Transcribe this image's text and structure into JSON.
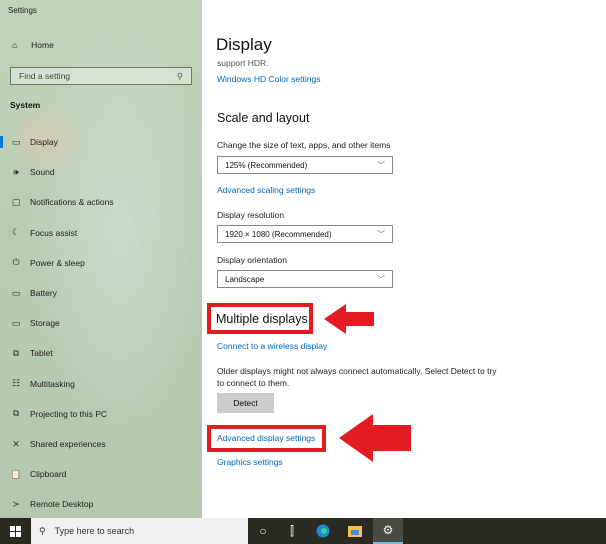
{
  "window": {
    "title": "Settings"
  },
  "sidebar": {
    "home_label": "Home",
    "search_placeholder": "Find a setting",
    "section": "System",
    "items": [
      {
        "label": "Display",
        "icon": "monitor-icon",
        "glyph": "▭",
        "active": true
      },
      {
        "label": "Sound",
        "icon": "speaker-icon",
        "glyph": "🕪"
      },
      {
        "label": "Notifications & actions",
        "icon": "notification-icon",
        "glyph": "▢"
      },
      {
        "label": "Focus assist",
        "icon": "moon-icon",
        "glyph": "☾"
      },
      {
        "label": "Power & sleep",
        "icon": "power-icon",
        "glyph": "⏻"
      },
      {
        "label": "Battery",
        "icon": "battery-icon",
        "glyph": "▭"
      },
      {
        "label": "Storage",
        "icon": "storage-icon",
        "glyph": "▭"
      },
      {
        "label": "Tablet",
        "icon": "tablet-icon",
        "glyph": "⧉"
      },
      {
        "label": "Multitasking",
        "icon": "multitasking-icon",
        "glyph": "☷"
      },
      {
        "label": "Projecting to this PC",
        "icon": "projecting-icon",
        "glyph": "⧉"
      },
      {
        "label": "Shared experiences",
        "icon": "shared-icon",
        "glyph": "✕"
      },
      {
        "label": "Clipboard",
        "icon": "clipboard-icon",
        "glyph": "📋"
      },
      {
        "label": "Remote Desktop",
        "icon": "remote-desktop-icon",
        "glyph": "≻"
      }
    ]
  },
  "main": {
    "title": "Display",
    "hdr_text": "support HDR.",
    "hdr_link": "Windows HD Color settings",
    "scale_heading": "Scale and layout",
    "scale_label": "Change the size of text, apps, and other items",
    "scale_value": "125% (Recommended)",
    "adv_scaling_link": "Advanced scaling settings",
    "resolution_label": "Display resolution",
    "resolution_value": "1920 × 1080 (Recommended)",
    "orientation_label": "Display orientation",
    "orientation_value": "Landscape",
    "multi_heading": "Multiple displays",
    "wireless_link": "Connect to a wireless display",
    "older_text": "Older displays might not always connect automatically. Select Detect to try to connect to them.",
    "detect_label": "Detect",
    "adv_display_link": "Advanced display settings",
    "graphics_link": "Graphics settings"
  },
  "annotations": {
    "color": "#e31b23"
  },
  "taskbar": {
    "search_placeholder": "Type here to search"
  }
}
